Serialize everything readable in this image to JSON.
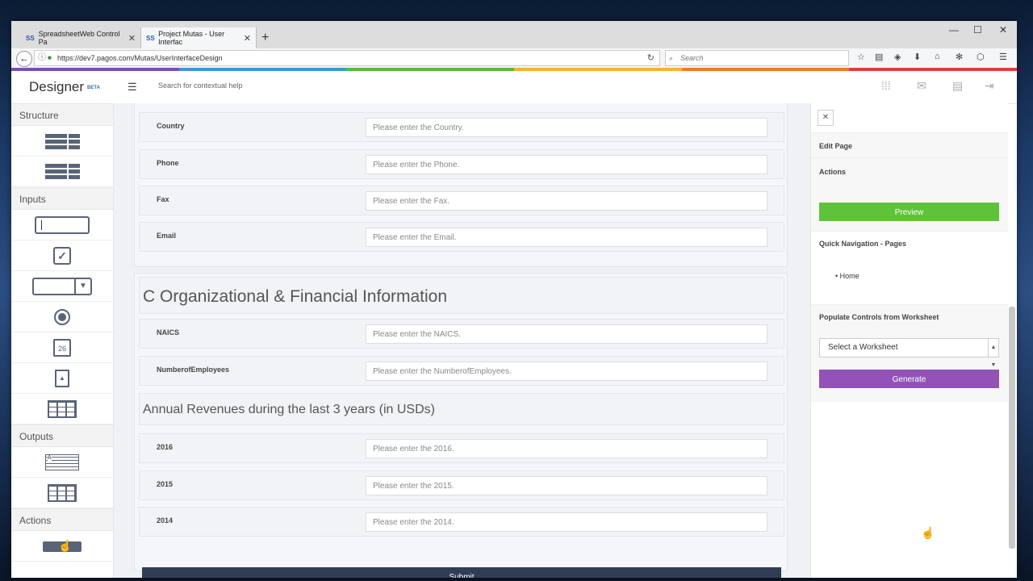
{
  "browser": {
    "tabs": [
      {
        "label": "SpreadsheetWeb Control Pa"
      },
      {
        "label": "Project Mutas - User Interfac"
      }
    ],
    "url": "https://dev7.pagos.com/Mutas/UserInterfaceDesign",
    "search_placeholder": "Search"
  },
  "rainbow_colors": [
    "#7a4fb0",
    "#3f96d0",
    "#59b947",
    "#f0b534",
    "#ec7b2c",
    "#e03e3b"
  ],
  "app": {
    "brand": "Designer",
    "beta": "BETA",
    "help_placeholder": "Search for contextual help"
  },
  "sidebar": {
    "sections": [
      "Structure",
      "Inputs",
      "Outputs",
      "Actions"
    ],
    "calendar_day": "26",
    "output_text_letter": "A"
  },
  "form": {
    "section_title": "C Organizational & Financial Information",
    "subsection_title": "Annual Revenues during the last 3 years (in USDs)",
    "fields_top": [
      {
        "label": "Country",
        "placeholder": "Please enter the Country."
      },
      {
        "label": "Phone",
        "placeholder": "Please enter the Phone."
      },
      {
        "label": "Fax",
        "placeholder": "Please enter the Fax."
      },
      {
        "label": "Email",
        "placeholder": "Please enter the Email."
      }
    ],
    "fields_org": [
      {
        "label": "NAICS",
        "placeholder": "Please enter the NAICS."
      },
      {
        "label": "NumberofEmployees",
        "placeholder": "Please enter the NumberofEmployees."
      }
    ],
    "fields_rev": [
      {
        "label": "2016",
        "placeholder": "Please enter the 2016."
      },
      {
        "label": "2015",
        "placeholder": "Please enter the 2015."
      },
      {
        "label": "2014",
        "placeholder": "Please enter the 2014."
      }
    ],
    "submit_label": "Submit"
  },
  "rightpanel": {
    "edit_page": "Edit Page",
    "actions": "Actions",
    "preview_label": "Preview",
    "quick_nav": "Quick Navigation - Pages",
    "home": "Home",
    "populate": "Populate Controls from Worksheet",
    "select_value": "Select a Worksheet",
    "generate_label": "Generate"
  }
}
